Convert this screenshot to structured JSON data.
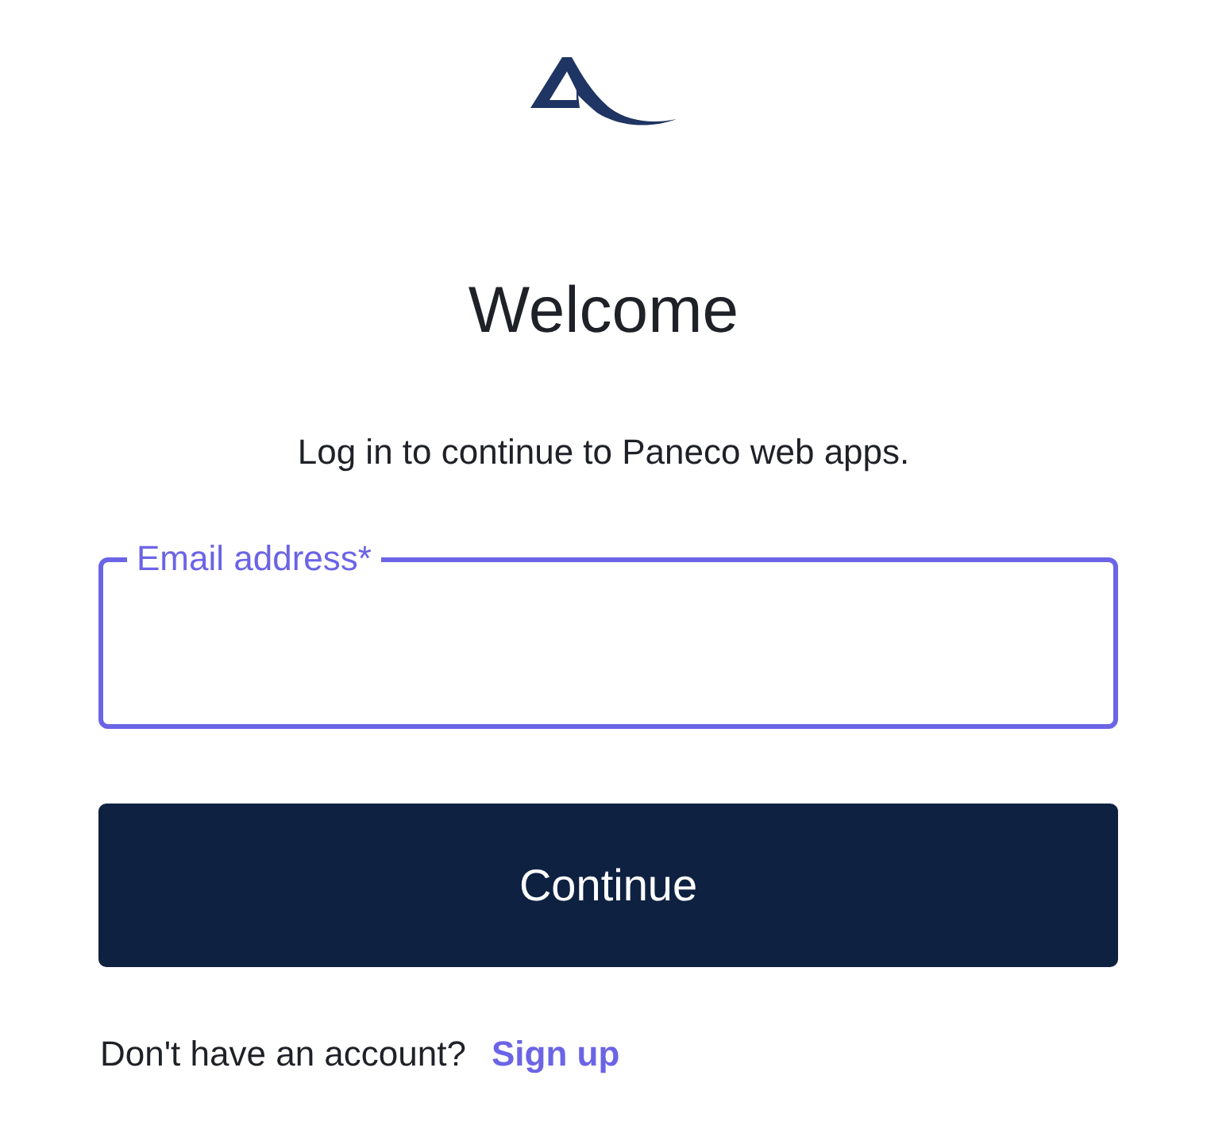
{
  "heading": "Welcome",
  "subtitle": "Log in to continue to Paneco web apps.",
  "email_field": {
    "label": "Email address*",
    "focused": true
  },
  "continue_button": "Continue",
  "signup_prompt": {
    "text": "Don't have an account?",
    "link": "Sign up"
  }
}
